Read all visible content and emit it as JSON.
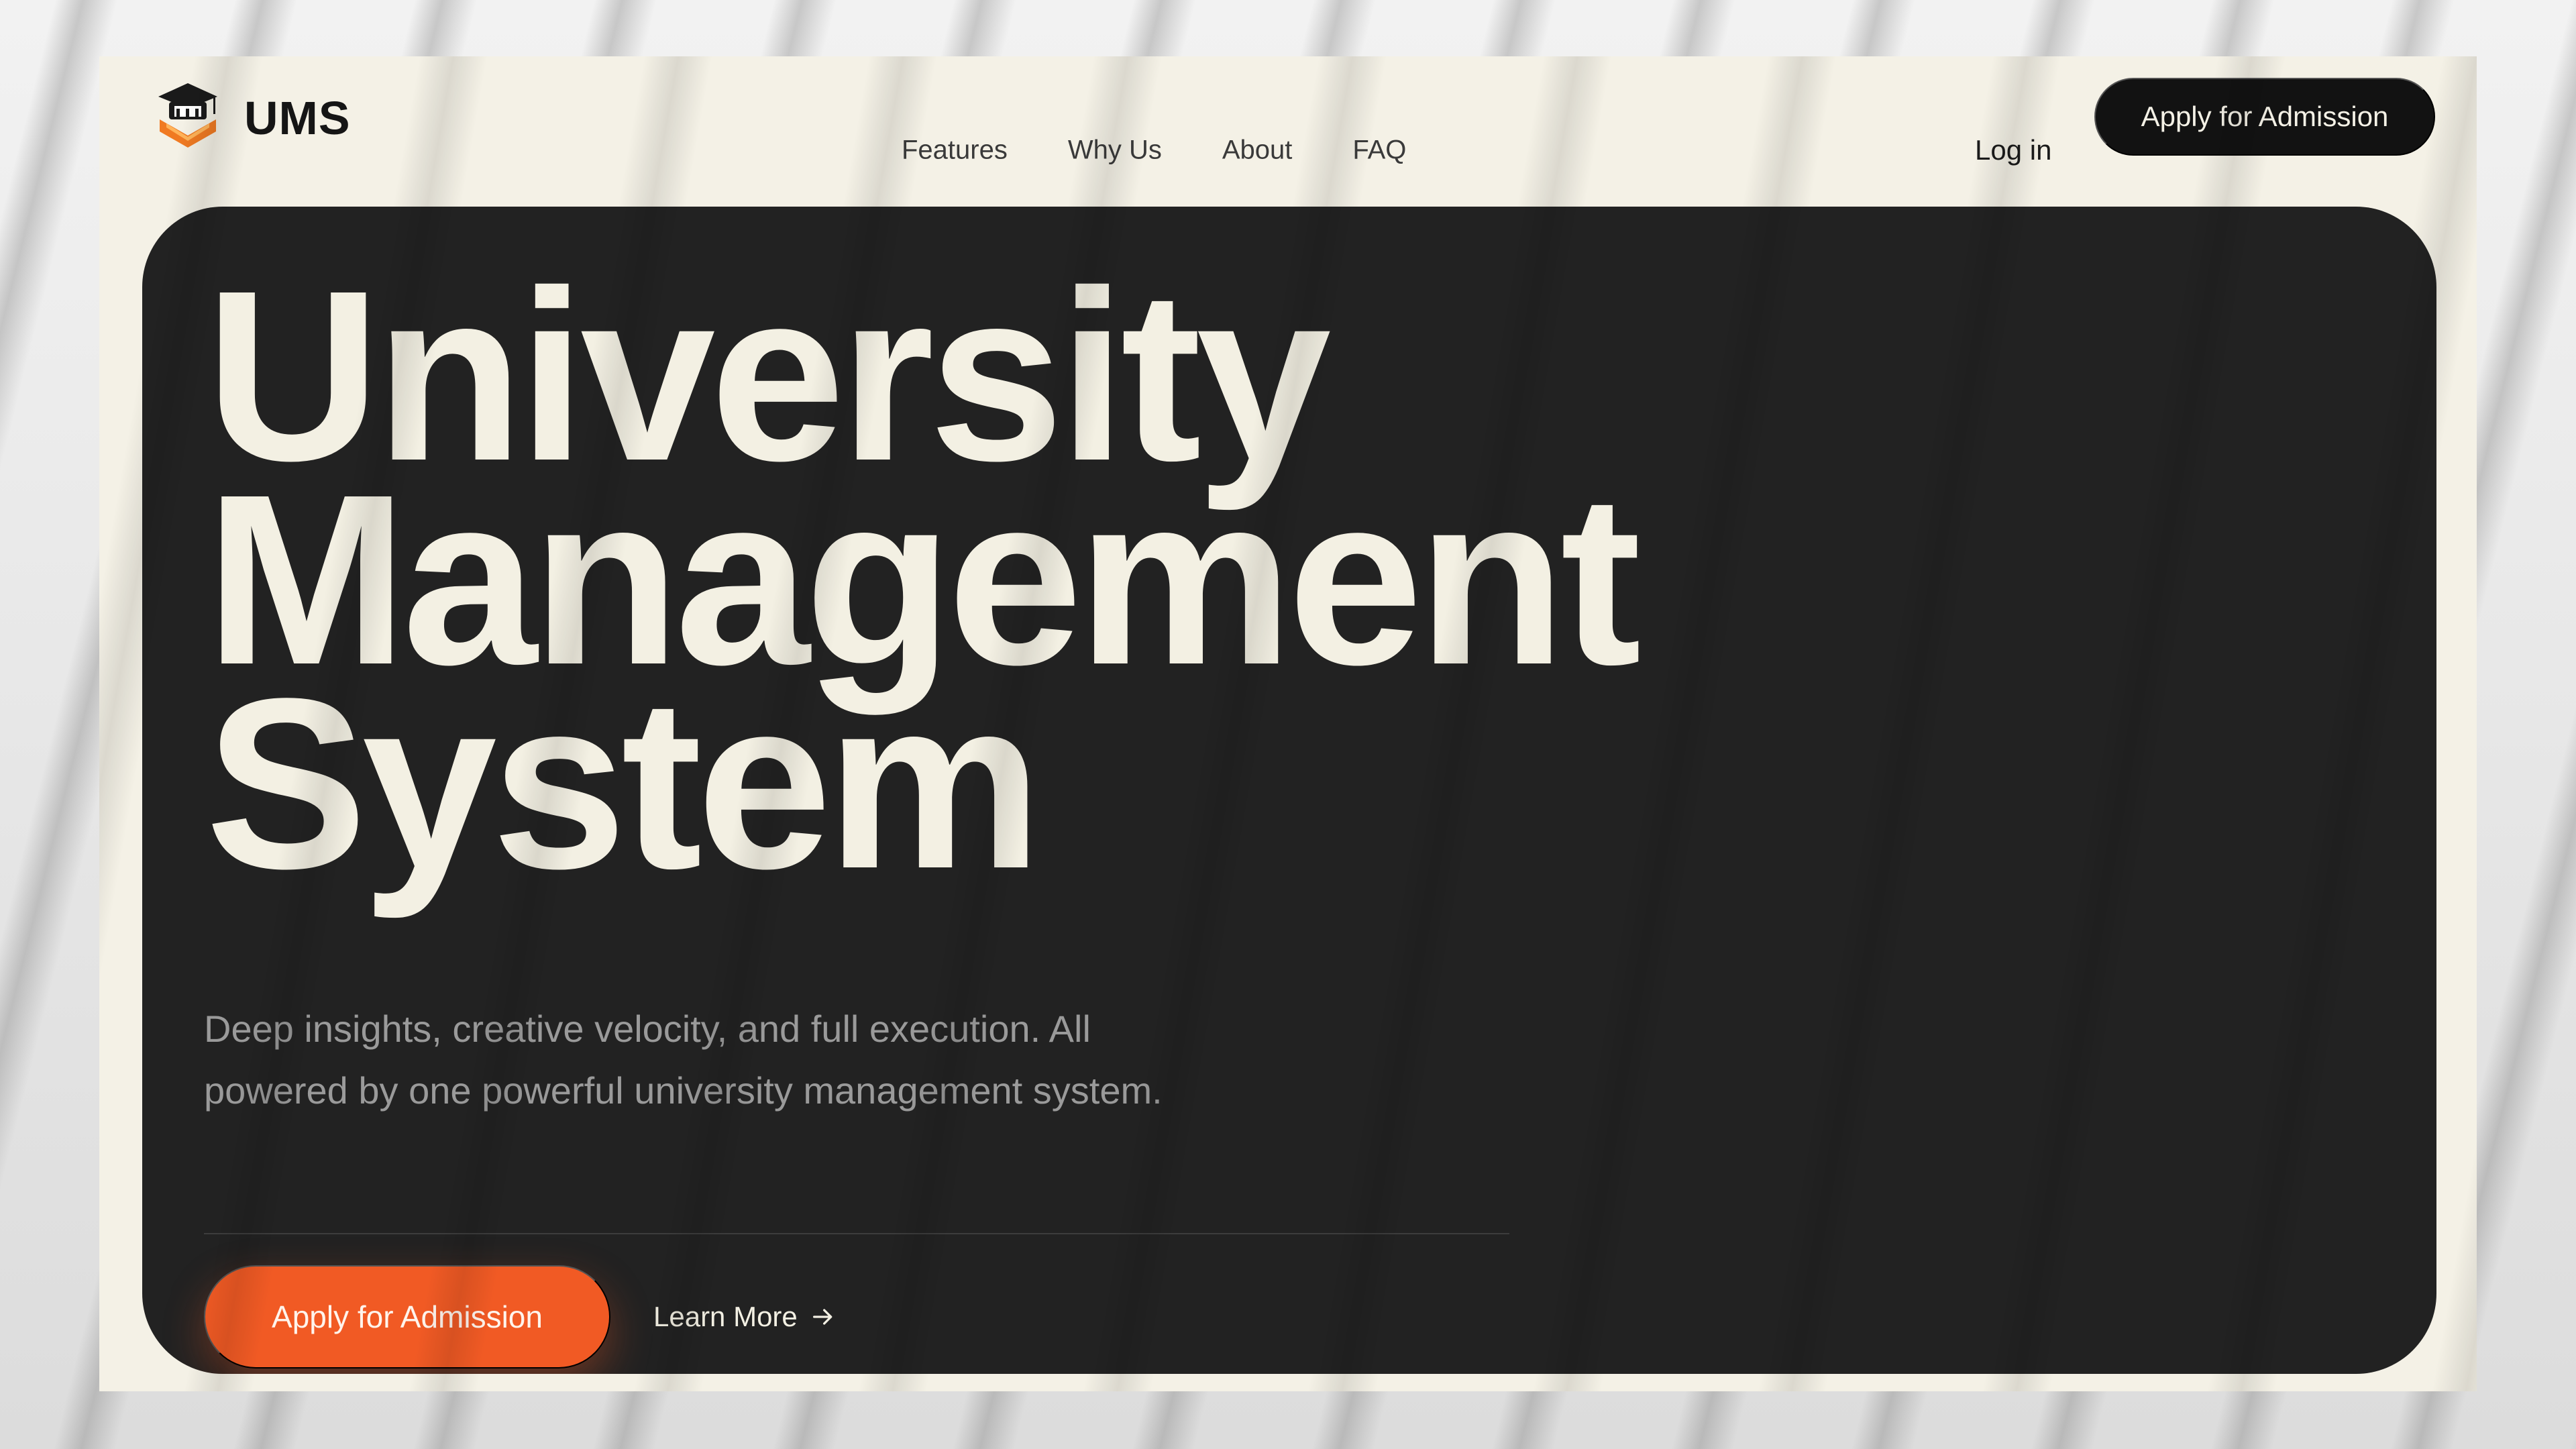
{
  "brand": {
    "name": "UMS"
  },
  "nav": {
    "links": [
      "Features",
      "Why Us",
      "About",
      "FAQ"
    ],
    "login": "Log in",
    "apply": "Apply for Admission"
  },
  "hero": {
    "title_line1": "University",
    "title_line2": "Management",
    "title_line3": "System",
    "description": "Deep insights, creative velocity, and full execution. All powered by one powerful university management system.",
    "primary_cta": "Apply for Admission",
    "secondary_cta": "Learn More"
  },
  "colors": {
    "page_bg": "#f4f1e6",
    "hero_bg": "#222222",
    "accent": "#f15a24",
    "nav_button": "#121212"
  },
  "icons": {
    "logo": "graduation-cap-book-logo",
    "learn_more": "arrow-right-icon"
  }
}
